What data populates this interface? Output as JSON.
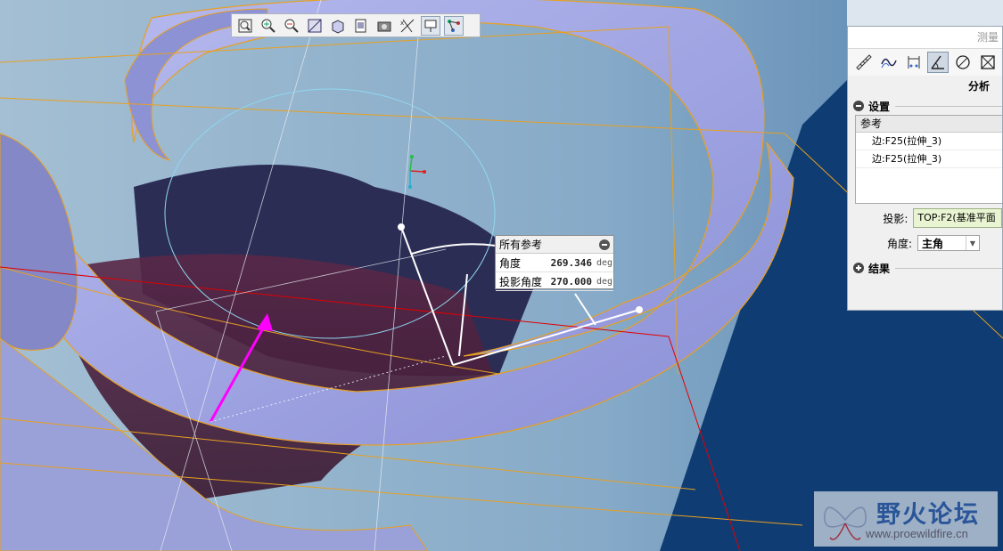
{
  "toolbar": {
    "buttons": [
      {
        "name": "refit-icon"
      },
      {
        "name": "zoom-in-icon"
      },
      {
        "name": "zoom-out-icon"
      },
      {
        "name": "repaint-icon"
      },
      {
        "name": "display-style-icon"
      },
      {
        "name": "saved-views-icon"
      },
      {
        "name": "view-manager-icon"
      },
      {
        "name": "datum-display-icon"
      },
      {
        "name": "annotation-display-icon"
      },
      {
        "name": "spin-center-icon"
      }
    ]
  },
  "callout": {
    "title": "所有参考",
    "rows": [
      {
        "label": "角度",
        "value": "269.346",
        "unit": "deg"
      },
      {
        "label": "投影角度",
        "value": "270.000",
        "unit": "deg"
      }
    ]
  },
  "panel": {
    "title": "测量",
    "tools": [
      "ruler-icon",
      "curve-length-icon",
      "distance-icon",
      "angle-icon",
      "diameter-icon",
      "area-icon"
    ],
    "active_tool": "angle-icon",
    "analysis_label": "分析",
    "settings_label": "设置",
    "references_header": "参考",
    "references": [
      "边:F25(拉伸_3)",
      "边:F25(拉伸_3)"
    ],
    "projection_label": "投影:",
    "projection_value": "TOP:F2(基准平面",
    "angle_label": "角度:",
    "angle_value": "主角",
    "results_label": "结果"
  },
  "watermark": {
    "cn": "野火论坛",
    "url": "www.proewildfire.cn"
  },
  "colors": {
    "background_light": "#a9c4d8",
    "background_dark": "#0d3b6f",
    "surface": "#9aa0e4",
    "edge": "#e8a020",
    "accent_magenta": "#ff00ff",
    "datum_red": "#e00000"
  }
}
